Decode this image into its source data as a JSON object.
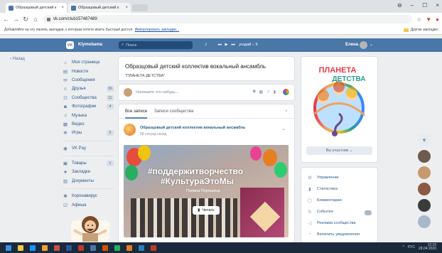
{
  "browser": {
    "tabs": [
      {
        "title": "Образцовый детский к",
        "close": "×"
      },
      {
        "title": "Образцовый детский к",
        "close": "×"
      }
    ],
    "window_controls": {
      "account": "⊖",
      "minimize": "–",
      "maximize": "☐",
      "close": "×"
    },
    "address": "vk.com/club157487489",
    "bookmarks_prompt": "Добавляйте на эту панель закладки, к которым хотите иметь быстрый доступ.",
    "bookmarks_import": "Импортировать закладки...",
    "other_bookmarks": "Другие закладки"
  },
  "vk": {
    "logo_text": "VK",
    "brand": "Klymobama",
    "search_placeholder": "Поиск",
    "player_track": "угадай – 9",
    "user_name": "Елена",
    "back_label": "Назад",
    "menu": [
      {
        "icon": "home-icon",
        "glyph": "⌂",
        "label": "Моя страница",
        "count": ""
      },
      {
        "icon": "news-icon",
        "glyph": "▤",
        "label": "Новости",
        "count": ""
      },
      {
        "icon": "messages-icon",
        "glyph": "✉",
        "label": "Сообщения",
        "count": ""
      },
      {
        "icon": "friends-icon",
        "glyph": "☺",
        "label": "Друзья",
        "count": "36"
      },
      {
        "icon": "communities-icon",
        "glyph": "☷",
        "label": "Сообщества",
        "count": "11"
      },
      {
        "icon": "photos-icon",
        "glyph": "◙",
        "label": "Фотографии",
        "count": "4"
      },
      {
        "icon": "music-icon",
        "glyph": "♫",
        "label": "Музыка",
        "count": ""
      },
      {
        "icon": "video-icon",
        "glyph": "▦",
        "label": "Видео",
        "count": ""
      },
      {
        "icon": "games-icon",
        "glyph": "✥",
        "label": "Игры",
        "count": "5"
      }
    ],
    "menu_pay": {
      "icon": "vkpay-icon",
      "glyph": "◉",
      "label": "VK Pay"
    },
    "menu_more": [
      {
        "icon": "goods-icon",
        "glyph": "▣",
        "label": "Товары",
        "count": "1"
      },
      {
        "icon": "bookmarks-icon",
        "glyph": "★",
        "label": "Закладки",
        "count": ""
      },
      {
        "icon": "documents-icon",
        "glyph": "▥",
        "label": "Документы",
        "count": ""
      }
    ],
    "menu_extra": [
      {
        "icon": "virus-icon",
        "glyph": "✺",
        "label": "Коронавирус"
      },
      {
        "icon": "poster-icon",
        "glyph": "☑",
        "label": "Афиша"
      }
    ]
  },
  "group": {
    "title": "Образцовый детский коллектив вокальный ансамбль",
    "status": "\"ПЛАНЕТА ДЕТСТВА\"",
    "composer_placeholder": "Напишите что-нибудь...",
    "wall_tabs": [
      "Все записи",
      "Записи сообщества"
    ],
    "post_author": "Образцовый детский коллектив вокальный ансамбль",
    "post_time": "58 секунд назад",
    "hashtag_1": "#поддержитворчество",
    "hashtag_2": "#КультураЭтоМы",
    "image_caption": "Полина Порошина",
    "read_button": "Читать"
  },
  "sidebar": {
    "logo_line1": "ПЛАНЕТА",
    "logo_line2": "ДЕТСТВА",
    "member_button": "Вы участник ⌄",
    "items": [
      {
        "icon": "gear-icon",
        "glyph": "⚙",
        "label": "Управление"
      },
      {
        "icon": "stats-icon",
        "glyph": "▮",
        "label": "Статистика"
      },
      {
        "icon": "comments-icon",
        "glyph": "▢",
        "label": "Комментарии"
      },
      {
        "icon": "events-icon",
        "glyph": "↻",
        "label": "События"
      },
      {
        "icon": "ads-icon",
        "glyph": "◁",
        "label": "Реклама сообщества"
      },
      {
        "icon": "notify-icon",
        "glyph": "◔",
        "label": "Включить уведомления"
      }
    ]
  },
  "tray": {
    "lang": "РУС",
    "time": "12:15",
    "date": "28.04.2020"
  },
  "colors": {
    "vk_blue": "#4a76a8",
    "link": "#2a5885",
    "bg": "#edeef0"
  }
}
